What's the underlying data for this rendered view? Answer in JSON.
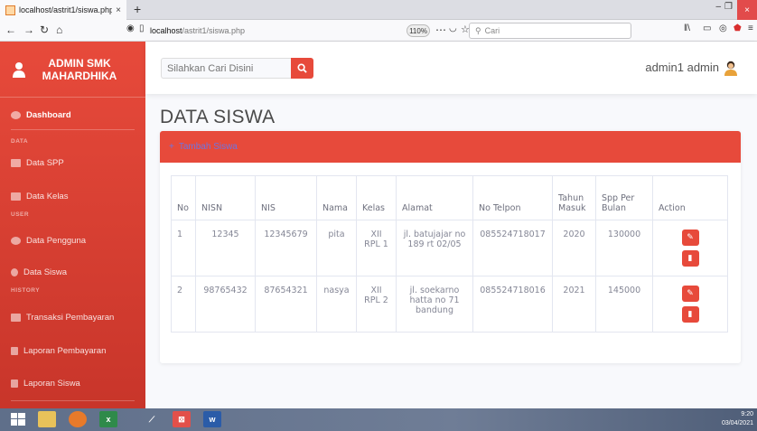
{
  "browser": {
    "tab_title": "localhost/astrit1/siswa.php",
    "tab_close": "×",
    "new_tab": "+",
    "url_host": "localhost",
    "url_path": "/astrit1/siswa.php",
    "zoom": "110%",
    "search_placeholder": "Cari",
    "win_close": "×"
  },
  "sidebar": {
    "brand": "ADMIN SMK MAHARDHIKA",
    "items": [
      {
        "label": "Dashboard"
      },
      {
        "label": "Data SPP"
      },
      {
        "label": "Data Kelas"
      },
      {
        "label": "Data Pengguna"
      },
      {
        "label": "Data Siswa"
      },
      {
        "label": "Transaksi Pembayaran"
      },
      {
        "label": "Laporan Pembayaran"
      },
      {
        "label": "Laporan Siswa"
      }
    ],
    "headings": {
      "data": "DATA",
      "user": "USER",
      "history": "HISTORY"
    }
  },
  "topbar": {
    "search_placeholder": "Silahkan Cari Disini",
    "username": "admin1 admin"
  },
  "main": {
    "title": "DATA SISWA",
    "add_button": "Tambah Siswa",
    "table": {
      "headers": [
        "No",
        "NISN",
        "NIS",
        "Nama",
        "Kelas",
        "Alamat",
        "No Telpon",
        "Tahun Masuk",
        "Spp Per Bulan",
        "Action"
      ],
      "rows": [
        {
          "no": "1",
          "nisn": "12345",
          "nis": "12345679",
          "nama": "pita",
          "kelas": "XII RPL 1",
          "alamat": "jl. batujajar no 189 rt 02/05",
          "telp": "085524718017",
          "tahun": "2020",
          "spp": "130000"
        },
        {
          "no": "2",
          "nisn": "98765432",
          "nis": "87654321",
          "nama": "nasya",
          "kelas": "XII RPL 2",
          "alamat": "jl. soekarno hatta no 71 bandung",
          "telp": "085524718016",
          "tahun": "2021",
          "spp": "145000"
        }
      ]
    }
  },
  "taskbar": {
    "time": "9:20",
    "date": "03/04/2021"
  }
}
